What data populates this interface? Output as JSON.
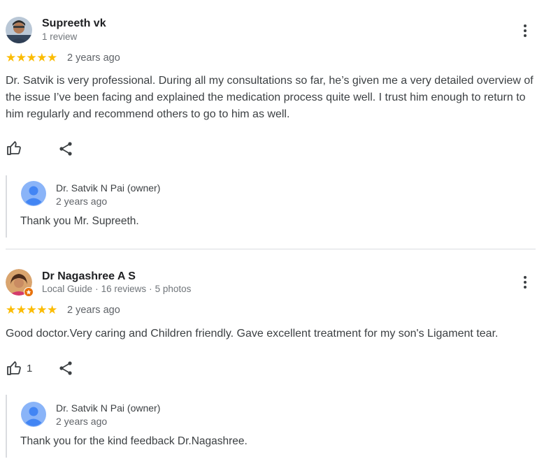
{
  "reviews": [
    {
      "author": {
        "name": "Supreeth vk",
        "meta": "1 review",
        "avatar_icon": "user-photo"
      },
      "rating": "★★★★★",
      "date": "2 years ago",
      "text": "Dr. Satvik is very professional. During all my consultations so far, he’s given me a very detailed overview of the issue I’ve been facing and explained the medication process quite well. I trust him enough to return to him regularly and recommend others to go to him as well.",
      "likes": "",
      "owner_reply": {
        "name": "Dr. Satvik N Pai (owner)",
        "date": "2 years ago",
        "text": "Thank you Mr. Supreeth."
      }
    },
    {
      "author": {
        "name": "Dr Nagashree A S",
        "meta_badge": "Local Guide",
        "meta_reviews": "16 reviews",
        "meta_photos": "5 photos",
        "avatar_icon": "user-photo"
      },
      "rating": "★★★★★",
      "date": "2 years ago",
      "text": "Good doctor.Very caring and Children friendly. Gave excellent treatment for my son's Ligament tear.",
      "likes": "1",
      "owner_reply": {
        "name": "Dr. Satvik N Pai (owner)",
        "date": "2 years ago",
        "text": "Thank you for the kind feedback Dr.Nagashree."
      }
    }
  ],
  "colors": {
    "star": "#fbbc04",
    "divider": "#dadce0",
    "avatar_default": "#8ab4f8",
    "local_guide_badge": "#e8710a"
  },
  "icons": {
    "like": "thumbs-up-icon",
    "share": "share-icon",
    "more": "more-vert-icon"
  }
}
